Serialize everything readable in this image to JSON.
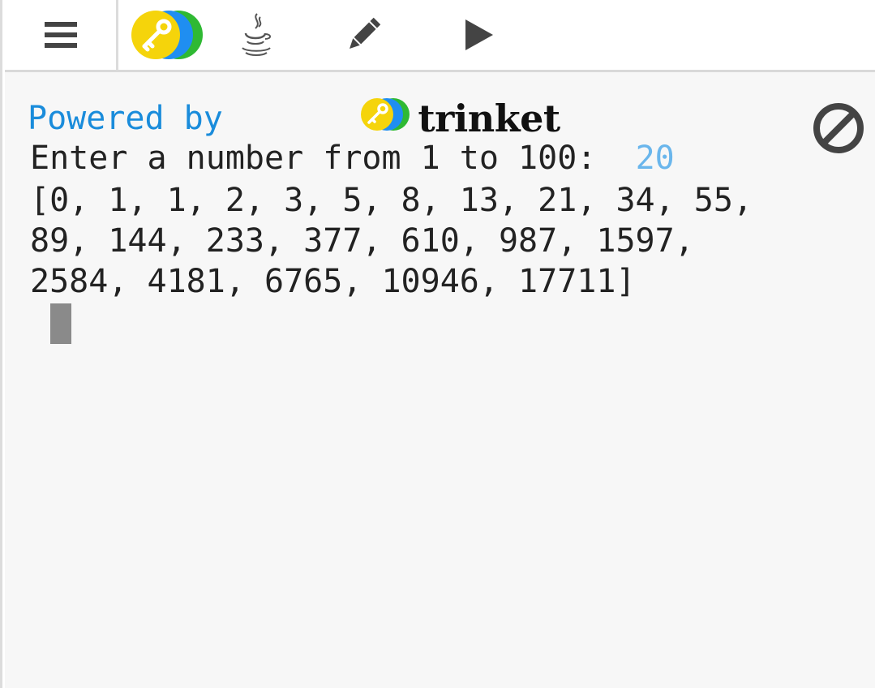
{
  "toolbar": {
    "menu_icon": "hamburger-menu-icon",
    "logo_icon": "trinket-logo-icon",
    "java_icon": "java-cup-icon",
    "edit_icon": "pencil-icon",
    "run_icon": "play-icon",
    "icon_color": "#444444"
  },
  "console": {
    "powered_by": "Powered by",
    "brand": "trinket",
    "prompt": "Enter a number from 1 to 100: ",
    "user_input": "20",
    "output_lines": [
      "[0, 1, 1, 2, 3, 5, 8, 13, 21, 34, 55,",
      "89, 144, 233, 377, 610, 987, 1597,",
      "2584, 4181, 6765, 10946, 17711]"
    ],
    "clear_icon": "no-entry-icon"
  },
  "colors": {
    "powered_by": "#1a8cdb",
    "user_input": "#6ab6ec",
    "logo_yellow": "#f5d40b",
    "logo_blue": "#1f8ef1",
    "logo_green": "#2fb933",
    "console_bg": "#f7f7f7"
  }
}
